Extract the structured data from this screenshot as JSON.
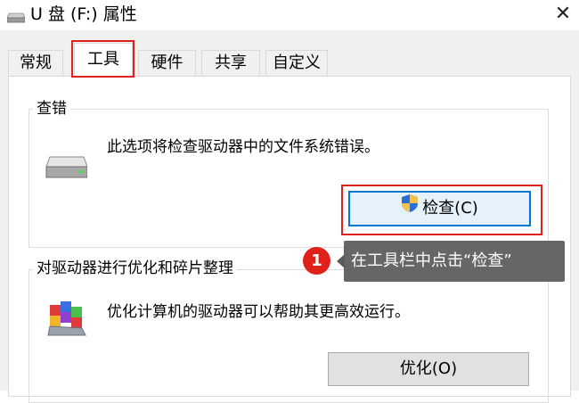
{
  "window": {
    "title": "U 盘 (F:) 属性",
    "close_label": "✕",
    "title_icon": "drive-icon"
  },
  "tabs": [
    {
      "label": "常规",
      "active": false
    },
    {
      "label": "工具",
      "active": true
    },
    {
      "label": "硬件",
      "active": false
    },
    {
      "label": "共享",
      "active": false
    },
    {
      "label": "自定义",
      "active": false
    }
  ],
  "check_group": {
    "title": "查错",
    "description": "此选项将检查驱动器中的文件系统错误。",
    "icon": "drive-icon",
    "button_label": "检查(C)",
    "button_icon": "uac-shield-icon"
  },
  "optimize_group": {
    "title": "对驱动器进行优化和碎片整理",
    "description": "优化计算机的驱动器可以帮助其更高效运行。",
    "icon": "defrag-icon",
    "button_label": "优化(O)"
  },
  "annotation": {
    "step_number": "1",
    "text": "在工具栏中点击“检查”",
    "highlight_color": "#e0201b"
  },
  "colors": {
    "accent": "#0078d7",
    "annotation_red": "#e0201b",
    "callout_bg": "#5a5a5a"
  }
}
